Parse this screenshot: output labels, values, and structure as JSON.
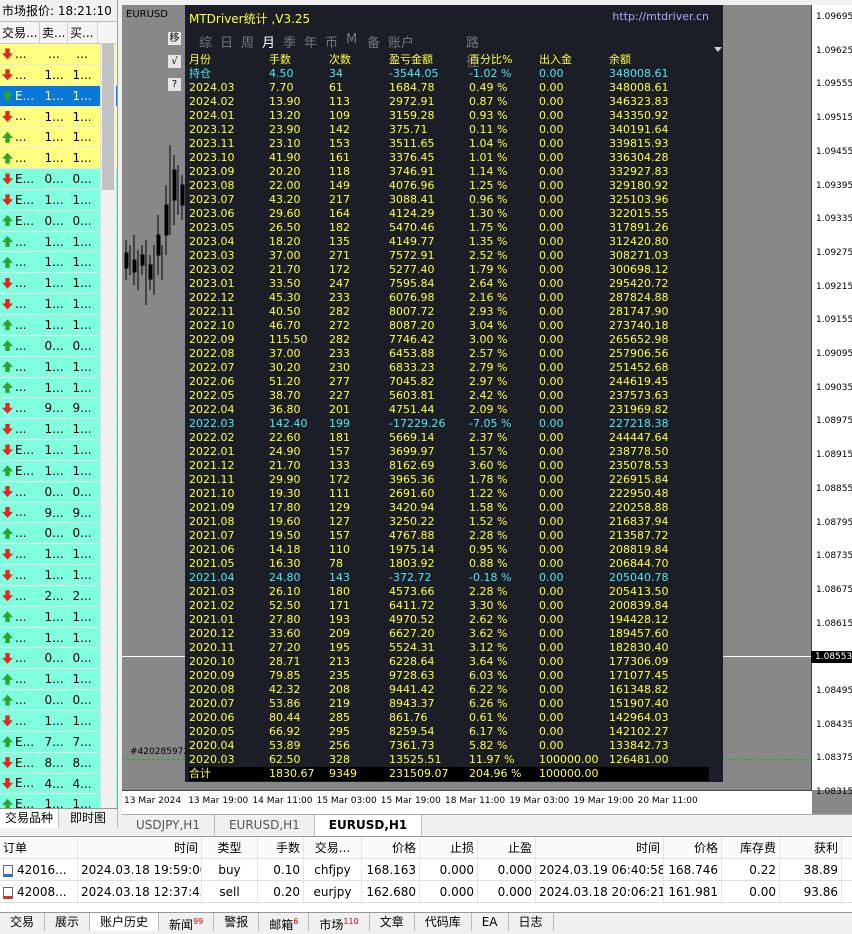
{
  "market_watch": {
    "title": "市场报价: 18:21:10",
    "headers": [
      "交易...",
      "卖...",
      "买..."
    ],
    "tabs": [
      "交易品种",
      "即时图"
    ],
    "rows": [
      {
        "dir": "dn",
        "sym": "...",
        "bid": "...",
        "ask": "...",
        "bg": "yel"
      },
      {
        "dir": "dn",
        "sym": "...",
        "bid": "1...",
        "ask": "1...",
        "bg": "yel"
      },
      {
        "dir": "up",
        "sym": "E...",
        "bid": "1...",
        "ask": "1...",
        "bg": "sel"
      },
      {
        "dir": "dn",
        "sym": "...",
        "bid": "1...",
        "ask": "1...",
        "bg": "yel"
      },
      {
        "dir": "up",
        "sym": "...",
        "bid": "1...",
        "ask": "1...",
        "bg": "yel"
      },
      {
        "dir": "up",
        "sym": "...",
        "bid": "1...",
        "ask": "1...",
        "bg": "yel"
      },
      {
        "dir": "dn",
        "sym": "E...",
        "bid": "0...",
        "ask": "0...",
        "bg": "cyn"
      },
      {
        "dir": "dn",
        "sym": "E...",
        "bid": "1...",
        "ask": "1...",
        "bg": "cyn"
      },
      {
        "dir": "up",
        "sym": "E...",
        "bid": "0...",
        "ask": "0...",
        "bg": "cyn"
      },
      {
        "dir": "up",
        "sym": "...",
        "bid": "1...",
        "ask": "1...",
        "bg": "cyn"
      },
      {
        "dir": "up",
        "sym": "...",
        "bid": "1...",
        "ask": "1...",
        "bg": "cyn"
      },
      {
        "dir": "dn",
        "sym": "...",
        "bid": "1...",
        "ask": "1...",
        "bg": "cyn"
      },
      {
        "dir": "dn",
        "sym": "...",
        "bid": "1...",
        "ask": "1...",
        "bg": "cyn"
      },
      {
        "dir": "up",
        "sym": "...",
        "bid": "1...",
        "ask": "1...",
        "bg": "cyn"
      },
      {
        "dir": "up",
        "sym": "...",
        "bid": "0...",
        "ask": "0...",
        "bg": "cyn"
      },
      {
        "dir": "up",
        "sym": "...",
        "bid": "1...",
        "ask": "1...",
        "bg": "cyn"
      },
      {
        "dir": "up",
        "sym": "...",
        "bid": "1...",
        "ask": "1...",
        "bg": "cyn"
      },
      {
        "dir": "dn",
        "sym": "...",
        "bid": "9...",
        "ask": "9...",
        "bg": "cyn"
      },
      {
        "dir": "dn",
        "sym": "...",
        "bid": "1...",
        "ask": "1...",
        "bg": "cyn"
      },
      {
        "dir": "dn",
        "sym": "E...",
        "bid": "1...",
        "ask": "1...",
        "bg": "cyn"
      },
      {
        "dir": "up",
        "sym": "E...",
        "bid": "1...",
        "ask": "1...",
        "bg": "cyn"
      },
      {
        "dir": "dn",
        "sym": "...",
        "bid": "0...",
        "ask": "0...",
        "bg": "cyn"
      },
      {
        "dir": "dn",
        "sym": "...",
        "bid": "9...",
        "ask": "9...",
        "bg": "cyn"
      },
      {
        "dir": "up",
        "sym": "...",
        "bid": "0...",
        "ask": "0...",
        "bg": "cyn"
      },
      {
        "dir": "dn",
        "sym": "...",
        "bid": "1...",
        "ask": "1...",
        "bg": "cyn"
      },
      {
        "dir": "dn",
        "sym": "...",
        "bid": "1...",
        "ask": "1...",
        "bg": "cyn"
      },
      {
        "dir": "dn",
        "sym": "...",
        "bid": "2...",
        "ask": "2...",
        "bg": "cyn"
      },
      {
        "dir": "up",
        "sym": "...",
        "bid": "1...",
        "ask": "1...",
        "bg": "cyn"
      },
      {
        "dir": "up",
        "sym": "...",
        "bid": "1...",
        "ask": "1...",
        "bg": "cyn"
      },
      {
        "dir": "dn",
        "sym": "...",
        "bid": "0...",
        "ask": "0...",
        "bg": "cyn"
      },
      {
        "dir": "up",
        "sym": "...",
        "bid": "1...",
        "ask": "1...",
        "bg": "cyn"
      },
      {
        "dir": "up",
        "sym": "...",
        "bid": "0...",
        "ask": "0...",
        "bg": "cyn"
      },
      {
        "dir": "dn",
        "sym": "...",
        "bid": "1...",
        "ask": "1...",
        "bg": "cyn"
      },
      {
        "dir": "up",
        "sym": "E...",
        "bid": "7...",
        "ask": "7...",
        "bg": "cyn"
      },
      {
        "dir": "dn",
        "sym": "E...",
        "bid": "8...",
        "ask": "8...",
        "bg": "cyn"
      },
      {
        "dir": "dn",
        "sym": "E...",
        "bid": "4...",
        "ask": "4...",
        "bg": "cyn"
      },
      {
        "dir": "up",
        "sym": "E...",
        "bid": "1...",
        "ask": "1...",
        "bg": "cyn"
      }
    ]
  },
  "chart": {
    "symbol_label": "EURUSD",
    "order_label": "#420285972",
    "current_price": "1.08553",
    "y_ticks": [
      "1.09695",
      "1.09625",
      "1.09555",
      "1.09515",
      "1.09455",
      "1.09395",
      "1.09335",
      "1.09275",
      "1.09215",
      "1.09155",
      "1.09095",
      "1.09035",
      "1.08975",
      "1.08915",
      "1.08855",
      "1.08795",
      "1.08735",
      "1.08675",
      "1.08615",
      "1.08555",
      "1.08495",
      "1.08435",
      "1.08375",
      "1.08315"
    ],
    "x_ticks": [
      "13 Mar 2024",
      "13 Mar 19:00",
      "14 Mar 11:00",
      "15 Mar 03:00",
      "15 Mar 19:00",
      "18 Mar 11:00",
      "19 Mar 03:00",
      "19 Mar 19:00",
      "20 Mar 11:00"
    ],
    "tabs": [
      "USDJPY,H1",
      "EURUSD,H1",
      "EURUSD,H1"
    ]
  },
  "driver": {
    "title": "MTDriver统计 ,V3.25",
    "url": "http://mtdriver.cn",
    "nav": [
      "综",
      "日",
      "周",
      "月",
      "季",
      "年",
      "币",
      "M",
      "备",
      "账户",
      "路径"
    ],
    "nav_active": "月",
    "side_buttons": [
      "移",
      "√",
      "?"
    ],
    "headers": [
      "月份",
      "手数",
      "次数",
      "盈亏金额",
      "百分比%",
      "出入金",
      "余额"
    ],
    "rows": [
      [
        "持仓",
        "4.50",
        "34",
        "-3544.05",
        "-1.02 %",
        "0.00",
        "348008.61"
      ],
      [
        "2024.03",
        "7.70",
        "61",
        "1684.78",
        "0.49 %",
        "0.00",
        "348008.61"
      ],
      [
        "2024.02",
        "13.90",
        "113",
        "2972.91",
        "0.87 %",
        "0.00",
        "346323.83"
      ],
      [
        "2024.01",
        "13.20",
        "109",
        "3159.28",
        "0.93 %",
        "0.00",
        "343350.92"
      ],
      [
        "2023.12",
        "23.90",
        "142",
        "375.71",
        "0.11 %",
        "0.00",
        "340191.64"
      ],
      [
        "2023.11",
        "23.10",
        "153",
        "3511.65",
        "1.04 %",
        "0.00",
        "339815.93"
      ],
      [
        "2023.10",
        "41.90",
        "161",
        "3376.45",
        "1.01 %",
        "0.00",
        "336304.28"
      ],
      [
        "2023.09",
        "20.20",
        "118",
        "3746.91",
        "1.14 %",
        "0.00",
        "332927.83"
      ],
      [
        "2023.08",
        "22.00",
        "149",
        "4076.96",
        "1.25 %",
        "0.00",
        "329180.92"
      ],
      [
        "2023.07",
        "43.20",
        "217",
        "3088.41",
        "0.96 %",
        "0.00",
        "325103.96"
      ],
      [
        "2023.06",
        "29.60",
        "164",
        "4124.29",
        "1.30 %",
        "0.00",
        "322015.55"
      ],
      [
        "2023.05",
        "26.50",
        "182",
        "5470.46",
        "1.75 %",
        "0.00",
        "317891.26"
      ],
      [
        "2023.04",
        "18.20",
        "135",
        "4149.77",
        "1.35 %",
        "0.00",
        "312420.80"
      ],
      [
        "2023.03",
        "37.00",
        "271",
        "7572.91",
        "2.52 %",
        "0.00",
        "308271.03"
      ],
      [
        "2023.02",
        "21.70",
        "172",
        "5277.40",
        "1.79 %",
        "0.00",
        "300698.12"
      ],
      [
        "2023.01",
        "33.50",
        "247",
        "7595.84",
        "2.64 %",
        "0.00",
        "295420.72"
      ],
      [
        "2022.12",
        "45.30",
        "233",
        "6076.98",
        "2.16 %",
        "0.00",
        "287824.88"
      ],
      [
        "2022.11",
        "40.50",
        "282",
        "8007.72",
        "2.93 %",
        "0.00",
        "281747.90"
      ],
      [
        "2022.10",
        "46.70",
        "272",
        "8087.20",
        "3.04 %",
        "0.00",
        "273740.18"
      ],
      [
        "2022.09",
        "115.50",
        "282",
        "7746.42",
        "3.00 %",
        "0.00",
        "265652.98"
      ],
      [
        "2022.08",
        "37.00",
        "233",
        "6453.88",
        "2.57 %",
        "0.00",
        "257906.56"
      ],
      [
        "2022.07",
        "30.20",
        "230",
        "6833.23",
        "2.79 %",
        "0.00",
        "251452.68"
      ],
      [
        "2022.06",
        "51.20",
        "277",
        "7045.82",
        "2.97 %",
        "0.00",
        "244619.45"
      ],
      [
        "2022.05",
        "38.70",
        "227",
        "5603.81",
        "2.42 %",
        "0.00",
        "237573.63"
      ],
      [
        "2022.04",
        "36.80",
        "201",
        "4751.44",
        "2.09 %",
        "0.00",
        "231969.82"
      ],
      [
        "2022.03",
        "142.40",
        "199",
        "-17229.26",
        "-7.05 %",
        "0.00",
        "227218.38"
      ],
      [
        "2022.02",
        "22.60",
        "181",
        "5669.14",
        "2.37 %",
        "0.00",
        "244447.64"
      ],
      [
        "2022.01",
        "24.90",
        "157",
        "3699.97",
        "1.57 %",
        "0.00",
        "238778.50"
      ],
      [
        "2021.12",
        "21.70",
        "133",
        "8162.69",
        "3.60 %",
        "0.00",
        "235078.53"
      ],
      [
        "2021.11",
        "29.90",
        "172",
        "3965.36",
        "1.78 %",
        "0.00",
        "226915.84"
      ],
      [
        "2021.10",
        "19.30",
        "111",
        "2691.60",
        "1.22 %",
        "0.00",
        "222950.48"
      ],
      [
        "2021.09",
        "17.80",
        "129",
        "3420.94",
        "1.58 %",
        "0.00",
        "220258.88"
      ],
      [
        "2021.08",
        "19.60",
        "127",
        "3250.22",
        "1.52 %",
        "0.00",
        "216837.94"
      ],
      [
        "2021.07",
        "19.50",
        "157",
        "4767.88",
        "2.28 %",
        "0.00",
        "213587.72"
      ],
      [
        "2021.06",
        "14.18",
        "110",
        "1975.14",
        "0.95 %",
        "0.00",
        "208819.84"
      ],
      [
        "2021.05",
        "16.30",
        "78",
        "1803.92",
        "0.88 %",
        "0.00",
        "206844.70"
      ],
      [
        "2021.04",
        "24.80",
        "143",
        "-372.72",
        "-0.18 %",
        "0.00",
        "205040.78"
      ],
      [
        "2021.03",
        "26.10",
        "180",
        "4573.66",
        "2.28 %",
        "0.00",
        "205413.50"
      ],
      [
        "2021.02",
        "52.50",
        "171",
        "6411.72",
        "3.30 %",
        "0.00",
        "200839.84"
      ],
      [
        "2021.01",
        "27.80",
        "193",
        "4970.52",
        "2.62 %",
        "0.00",
        "194428.12"
      ],
      [
        "2020.12",
        "33.60",
        "209",
        "6627.20",
        "3.62 %",
        "0.00",
        "189457.60"
      ],
      [
        "2020.11",
        "27.20",
        "195",
        "5524.31",
        "3.12 %",
        "0.00",
        "182830.40"
      ],
      [
        "2020.10",
        "28.71",
        "213",
        "6228.64",
        "3.64 %",
        "0.00",
        "177306.09"
      ],
      [
        "2020.09",
        "79.85",
        "235",
        "9728.63",
        "6.03 %",
        "0.00",
        "171077.45"
      ],
      [
        "2020.08",
        "42.32",
        "208",
        "9441.42",
        "6.22 %",
        "0.00",
        "161348.82"
      ],
      [
        "2020.07",
        "53.86",
        "219",
        "8943.37",
        "6.26 %",
        "0.00",
        "151907.40"
      ],
      [
        "2020.06",
        "80.44",
        "285",
        "861.76",
        "0.61 %",
        "0.00",
        "142964.03"
      ],
      [
        "2020.05",
        "66.92",
        "295",
        "8259.54",
        "6.17 %",
        "0.00",
        "142102.27"
      ],
      [
        "2020.04",
        "53.89",
        "256",
        "7361.73",
        "5.82 %",
        "0.00",
        "133842.73"
      ],
      [
        "2020.03",
        "62.50",
        "328",
        "13525.51",
        "11.97 %",
        "100000.00",
        "126481.00"
      ]
    ],
    "cyan_rows": [
      0,
      25,
      36
    ],
    "total": [
      "合计",
      "1830.67",
      "9349",
      "231509.07",
      "204.96 %",
      "100000.00",
      ""
    ]
  },
  "terminal": {
    "headers": [
      "订单",
      "时间",
      "类型",
      "手数",
      "交易...",
      "价格",
      "止损",
      "止盈",
      "时间",
      "价格",
      "库存费",
      "获利"
    ],
    "rows": [
      [
        "42016...",
        "2024.03.18 19:59:00",
        "buy",
        "0.10",
        "chfjpy",
        "168.163",
        "0.000",
        "0.000",
        "2024.03.19 06:40:58",
        "168.746",
        "0.22",
        "38.89"
      ],
      [
        "42008...",
        "2024.03.18 12:37:43",
        "sell",
        "0.20",
        "eurjpy",
        "162.680",
        "0.000",
        "0.000",
        "2024.03.18 20:06:21",
        "161.981",
        "0.00",
        "93.86"
      ]
    ],
    "tabs": [
      {
        "label": "交易",
        "badge": ""
      },
      {
        "label": "展示",
        "badge": ""
      },
      {
        "label": "账户历史",
        "badge": ""
      },
      {
        "label": "新闻",
        "badge": "99"
      },
      {
        "label": "警报",
        "badge": ""
      },
      {
        "label": "邮箱",
        "badge": "6"
      },
      {
        "label": "市场",
        "badge": "110"
      },
      {
        "label": "文章",
        "badge": ""
      },
      {
        "label": "代码库",
        "badge": ""
      },
      {
        "label": "EA",
        "badge": ""
      },
      {
        "label": "日志",
        "badge": ""
      }
    ],
    "active_tab": 2
  }
}
